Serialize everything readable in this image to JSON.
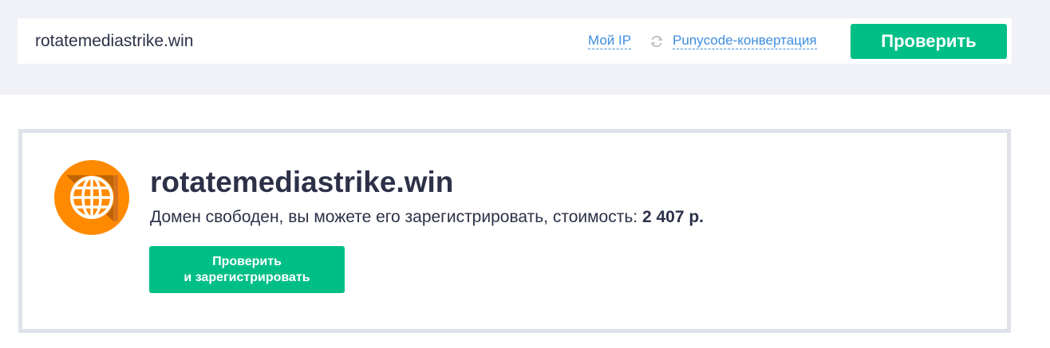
{
  "search": {
    "value": "rotatemediastrike.win",
    "my_ip_label": "Мой IP",
    "punycode_label": "Punycode-конвертация",
    "refresh_icon": "refresh-icon",
    "check_label": "Проверить"
  },
  "result": {
    "icon": "globe-icon",
    "domain": "rotatemediastrike.win",
    "status_text": "Домен свободен, вы можете его зарегистрировать, стоимость:",
    "price": "2 407 р.",
    "register_line1": "Проверить",
    "register_line2": "и зарегистрировать"
  },
  "colors": {
    "accent_green": "#00bf86",
    "link_blue": "#3d8fe0",
    "badge_orange": "#ff8a00",
    "text_dark": "#2c3148",
    "band_gray": "#f1f2f7"
  }
}
